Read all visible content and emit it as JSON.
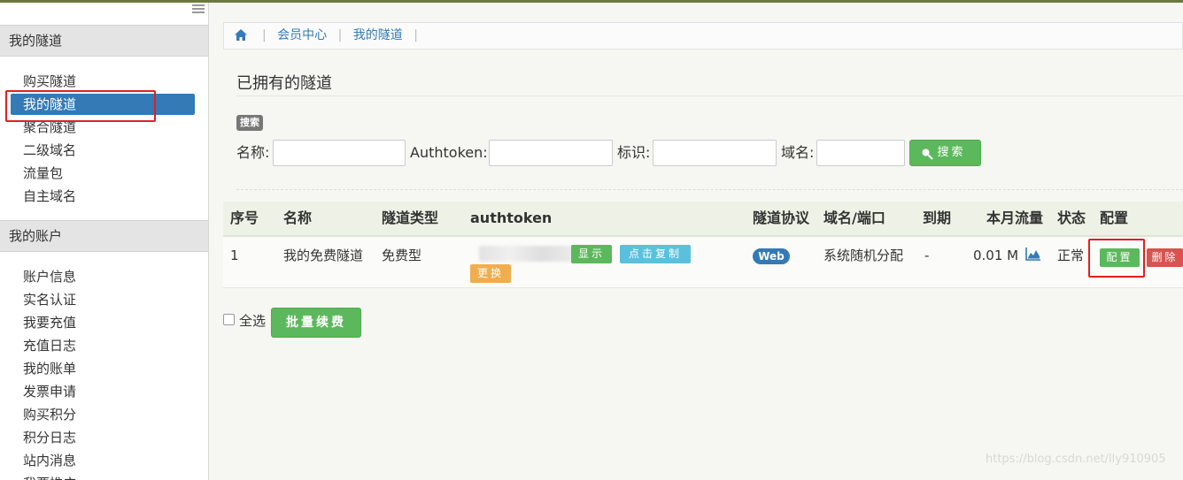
{
  "sidebar": {
    "tunnels_section": "我的隧道",
    "tunnel_items": [
      "购买隧道",
      "我的隧道",
      "聚合隧道",
      "二级域名",
      "流量包",
      "自主域名"
    ],
    "account_section": "我的账户",
    "account_items": [
      "账户信息",
      "实名认证",
      "我要充值",
      "充值日志",
      "我的账单",
      "发票申请",
      "购买积分",
      "积分日志",
      "站内消息",
      "我要推广"
    ]
  },
  "breadcrumb": {
    "home_icon": "home-icon",
    "items": [
      "会员中心",
      "我的隧道"
    ]
  },
  "page": {
    "title": "已拥有的隧道",
    "search_badge": "搜索"
  },
  "search": {
    "name_label": "名称:",
    "authtoken_label": "Authtoken:",
    "tag_label": "标识:",
    "domain_label": "域名:",
    "button_label": "搜索",
    "button_icon": "search-icon"
  },
  "table": {
    "headers": [
      "序号",
      "名称",
      "隧道类型",
      "authtoken",
      "隧道协议",
      "域名/端口",
      "到期",
      "本月流量",
      "状态",
      "配置"
    ],
    "rows": [
      {
        "index": "1",
        "name": "我的免费隧道",
        "type": "免费型",
        "show_label": "显示",
        "copy_label": "点击复制",
        "change_label": "更换",
        "protocol": "Web",
        "domain": "系统随机分配",
        "expire": "-",
        "traffic": "0.01 M",
        "status": "正常",
        "config_label": "配置",
        "delete_label": "删除"
      }
    ]
  },
  "footer": {
    "select_all": "全选",
    "batch_renew": "批量续费"
  },
  "watermark": "https://blog.csdn.net/lly910905",
  "colors": {
    "primary": "#337ab7",
    "success": "#5cb85c",
    "info": "#5bc0de",
    "warning": "#f0ad4e",
    "danger": "#d9534f",
    "highlight": "#e02020"
  }
}
